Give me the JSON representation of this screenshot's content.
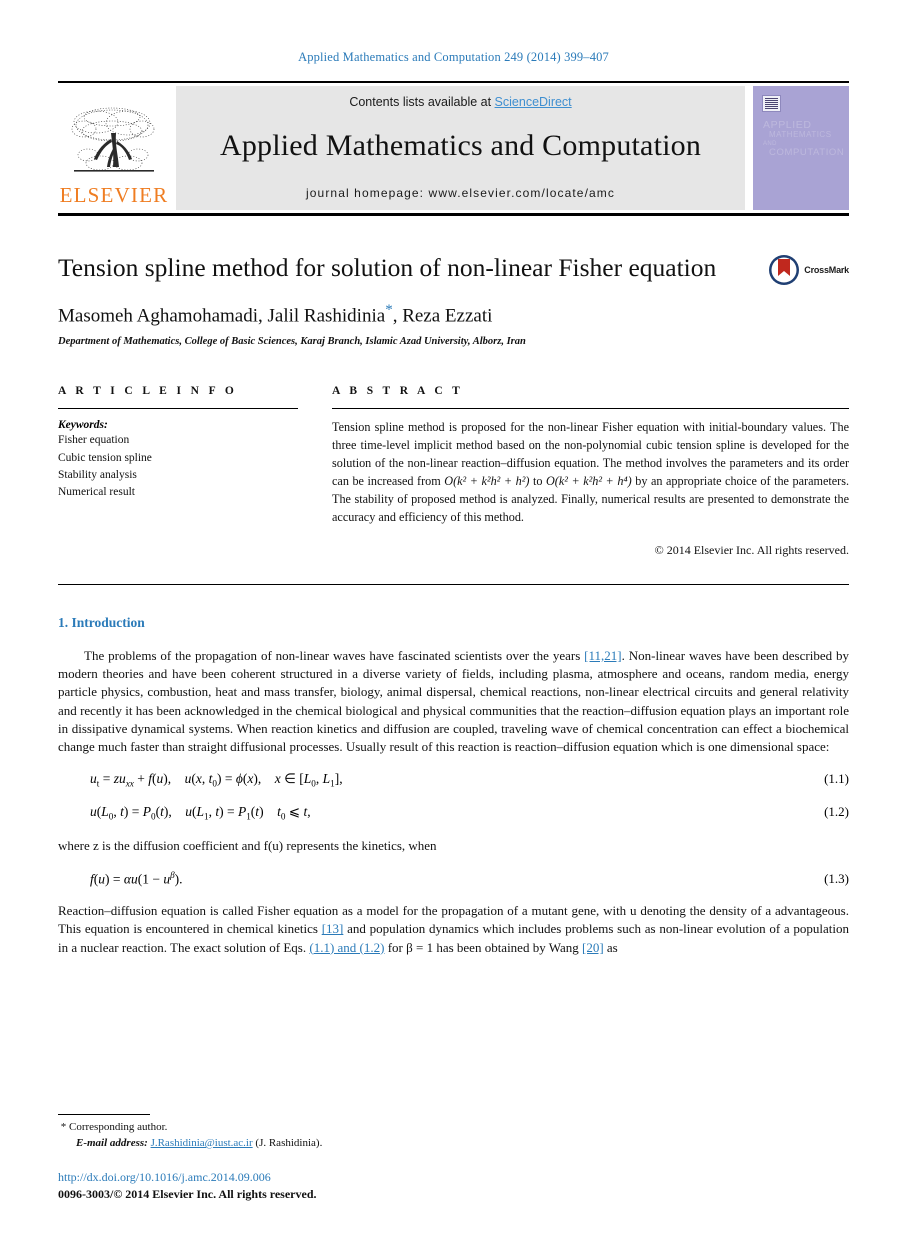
{
  "running_head": "Applied Mathematics and Computation 249 (2014) 399–407",
  "masthead": {
    "contents_prefix": "Contents lists available at ",
    "sciencedirect": "ScienceDirect",
    "journal_name": "Applied Mathematics and Computation",
    "homepage": "journal homepage: www.elsevier.com/locate/amc",
    "publisher_wordmark": "ELSEVIER",
    "cover_line1": "APPLIED",
    "cover_line2": "MATHEMATICS",
    "cover_line3": "AND",
    "cover_line4": "COMPUTATION"
  },
  "article": {
    "title": "Tension spline method for solution of non-linear Fisher equation",
    "authors_before_star": "Masomeh Aghamohamadi, Jalil Rashidinia",
    "corresponding_marker": "*",
    "authors_after_star": ", Reza Ezzati",
    "affiliation": "Department of Mathematics, College of Basic Sciences, Karaj Branch, Islamic Azad University, Alborz, Iran",
    "crossmark_label": "CrossMark"
  },
  "article_info": {
    "heading": "A R T I C L E   I N F O",
    "keywords_label": "Keywords:",
    "keywords": [
      "Fisher equation",
      "Cubic tension spline",
      "Stability analysis",
      "Numerical result"
    ]
  },
  "abstract": {
    "heading": "A B S T R A C T",
    "part1": "Tension spline method is proposed for the non-linear Fisher equation with initial-boundary values. The three time-level implicit method based on the non-polynomial cubic tension spline is developed for the solution of the non-linear reaction–diffusion equation. The method involves the parameters and its order can be increased from ",
    "order_from": "O(k² + k²h² + h²)",
    "part2": " to ",
    "order_to": "O(k² + k²h² + h⁴)",
    "part3": " by an appropriate choice of the parameters. The stability of proposed method is analyzed. Finally, numerical results are presented to demonstrate the accuracy and efficiency of this method.",
    "copyright": "© 2014 Elsevier Inc. All rights reserved."
  },
  "body": {
    "section_heading": "1. Introduction",
    "p1_a": "The problems of the propagation of non-linear waves have fascinated scientists over the years ",
    "p1_ref": "[11,21]",
    "p1_b": ". Non-linear waves have been described by modern theories and have been coherent structured in a diverse variety of fields, including plasma, atmosphere and oceans, random media, energy particle physics, combustion, heat and mass transfer, biology, animal dispersal, chemical reactions, non-linear electrical circuits and general relativity and recently it has been acknowledged in the chemical biological and physical communities that the reaction–diffusion equation plays an important role in dissipative dynamical systems. When reaction kinetics and diffusion are coupled, traveling wave of chemical concentration can effect a biochemical change much faster than straight diffusional processes. Usually result of this reaction is reaction–diffusion equation which is one dimensional space:",
    "eq11_text": "u_t = zu_xx + f(u),  u(x, t_0) = φ(x),  x ∈ [L_0, L_1],",
    "eq11_num": "(1.1)",
    "eq12_text": "u(L_0, t) = P_0(t),  u(L_1, t) = P_1(t)  t_0 ⩽ t,",
    "eq12_num": "(1.2)",
    "p2": "where z is the diffusion coefficient and f(u) represents the kinetics, when",
    "eq13_text": "f(u) = αu(1 − u^β).",
    "eq13_num": "(1.3)",
    "p3_a": "Reaction–diffusion equation is called Fisher equation as a model for the propagation of a mutant gene, with u denoting the density of a advantageous. This equation is encountered in chemical kinetics ",
    "p3_ref1": "[13]",
    "p3_b": " and population dynamics which includes problems such as non-linear evolution of a population in a nuclear reaction. The exact solution of Eqs. ",
    "p3_ref2": "(1.1) and (1.2)",
    "p3_c": " for β = 1 has been obtained by Wang ",
    "p3_ref3": "[20]",
    "p3_d": " as"
  },
  "footer": {
    "corresponding_marker": "*",
    "corresponding_text": "Corresponding author.",
    "email_label": "E-mail address:",
    "email": "J.Rashidinia@iust.ac.ir",
    "email_owner": "(J. Rashidinia).",
    "doi": "http://dx.doi.org/10.1016/j.amc.2014.09.006",
    "issn_line": "0096-3003/© 2014 Elsevier Inc. All rights reserved."
  },
  "colors": {
    "link": "#2b7bb9",
    "elsevier_orange": "#ef7d22",
    "masthead_gray": "#e6e6e6",
    "cover_purple": "#a9a3d4"
  }
}
